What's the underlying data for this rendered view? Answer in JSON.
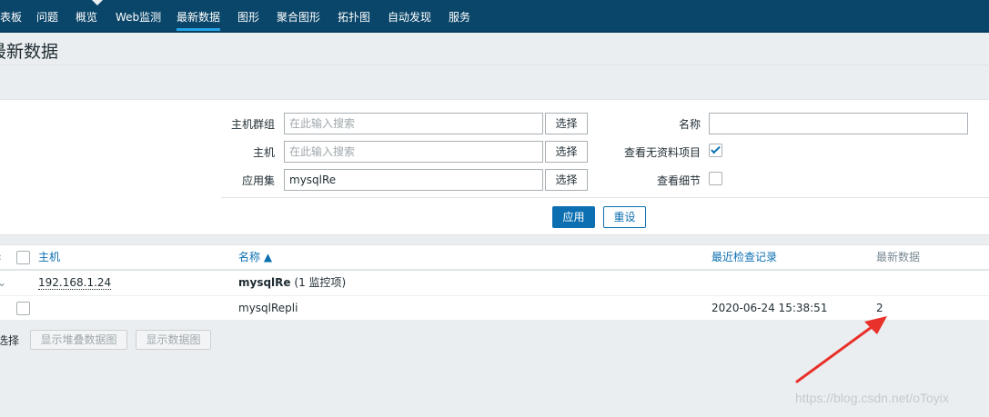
{
  "nav": {
    "items": [
      {
        "label": "表板",
        "active": false
      },
      {
        "label": "问题",
        "active": false
      },
      {
        "label": "概览",
        "active": false
      },
      {
        "label": "Web监测",
        "active": false
      },
      {
        "label": "最新数据",
        "active": true
      },
      {
        "label": "图形",
        "active": false
      },
      {
        "label": "聚合图形",
        "active": false
      },
      {
        "label": "拓扑图",
        "active": false
      },
      {
        "label": "自动发现",
        "active": false
      },
      {
        "label": "服务",
        "active": false
      }
    ]
  },
  "page": {
    "title": "最新数据"
  },
  "filter": {
    "host_group": {
      "label": "主机群组",
      "placeholder": "在此输入搜索",
      "value": "",
      "select_label": "选择"
    },
    "host": {
      "label": "主机",
      "placeholder": "在此输入搜索",
      "value": "",
      "select_label": "选择"
    },
    "application": {
      "label": "应用集",
      "value": "mysqlRe",
      "select_label": "选择"
    },
    "name": {
      "label": "名称",
      "value": ""
    },
    "show_items_without_data": {
      "label": "查看无资料项目",
      "checked": true
    },
    "show_details": {
      "label": "查看细节",
      "checked": false
    },
    "apply_label": "应用",
    "reset_label": "重设"
  },
  "table": {
    "headers": {
      "host": "主机",
      "name": "名称 ▲",
      "last_check": "最近检查记录",
      "last_value": "最新数据"
    },
    "host_row": {
      "host": "192.168.1.24",
      "app_name": "mysqlRe",
      "app_count": "(1 监控项)"
    },
    "item_rows": [
      {
        "name": "mysqlRepli",
        "last_check": "2020-06-24 15:38:51",
        "last_value": "2"
      }
    ]
  },
  "actions": {
    "label": "选择",
    "stacked_graph_label": "显示堆叠数据图",
    "graph_label": "显示数据图"
  },
  "annotation": {
    "color": "#e8312a"
  },
  "watermark": "https://blog.csdn.net/oToyix"
}
